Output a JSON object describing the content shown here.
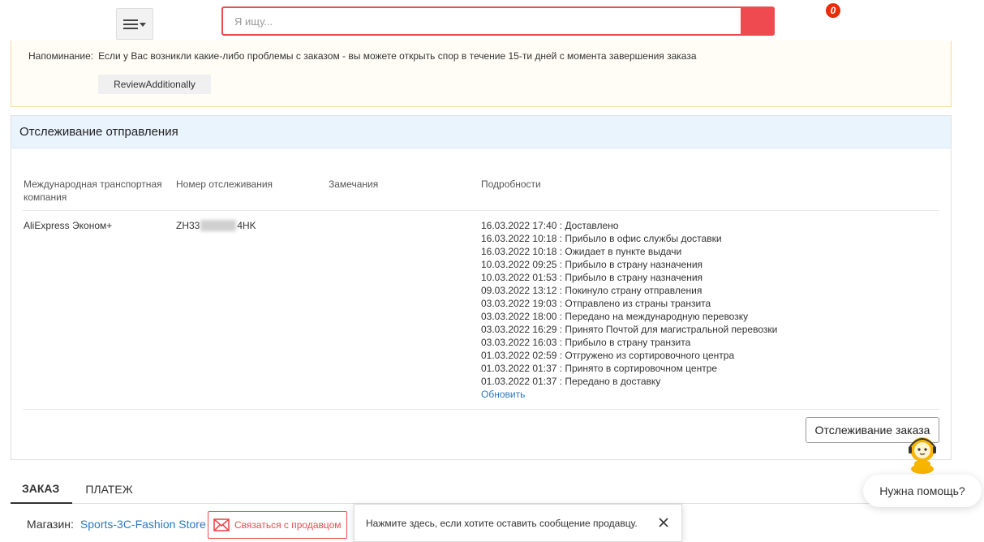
{
  "header": {
    "search_placeholder": "Я ищу...",
    "cart_count": "0"
  },
  "reminder": {
    "label": "Напоминание:",
    "text": "Если у Вас возникли какие-либо проблемы с заказом - вы можете открыть спор в течение 15-ти дней с момента завершения заказа",
    "review_button": "ReviewAdditionally"
  },
  "tracking": {
    "title": "Отслеживание отправления",
    "columns": {
      "carrier": "Международная транспортная компания",
      "tracking_number": "Номер отслеживания",
      "remarks": "Замечания",
      "details": "Подробности"
    },
    "carrier": "AliExpress Эконом+",
    "tracking_prefix": "ZH33",
    "tracking_suffix": "4HK",
    "events": [
      "16.03.2022 17:40 : Доставлено",
      "16.03.2022 10:18 : Прибыло в офис службы доставки",
      "16.03.2022 10:18 : Ожидает в пункте выдачи",
      "10.03.2022 09:25 : Прибыло в страну назначения",
      "10.03.2022 01:53 : Прибыло в страну назначения",
      "09.03.2022 13:12 : Покинуло страну отправления",
      "03.03.2022 19:03 : Отправлено из страны транзита",
      "03.03.2022 18:00 : Передано на международную перевозку",
      "03.03.2022 16:29 : Принято Почтой для магистральной перевозки",
      "03.03.2022 16:03 : Прибыло в страну транзита",
      "01.03.2022 02:59 : Отгружено из сортировочного центра",
      "01.03.2022 01:37 : Принято в сортировочном центре",
      "01.03.2022 01:37 : Передано в доставку"
    ],
    "refresh_link": "Обновить",
    "track_order_button": "Отслеживание заказа"
  },
  "tabs": [
    "ЗАКАЗ",
    "ПЛАТЕЖ"
  ],
  "store": {
    "label": "Магазин:",
    "name": "Sports-3C-Fashion Store",
    "contact_button": "Связаться с продавцом",
    "tooltip_text": "Нажмите здесь, если хотите оставить сообщение продавцу."
  },
  "help": {
    "bubble_text": "Нужна помощь?"
  },
  "colors": {
    "accent": "#ef4a4f",
    "link": "#2a7ac0",
    "tracking_header_bg": "#eaf4fd",
    "reminder_bg": "#fffdf6"
  }
}
